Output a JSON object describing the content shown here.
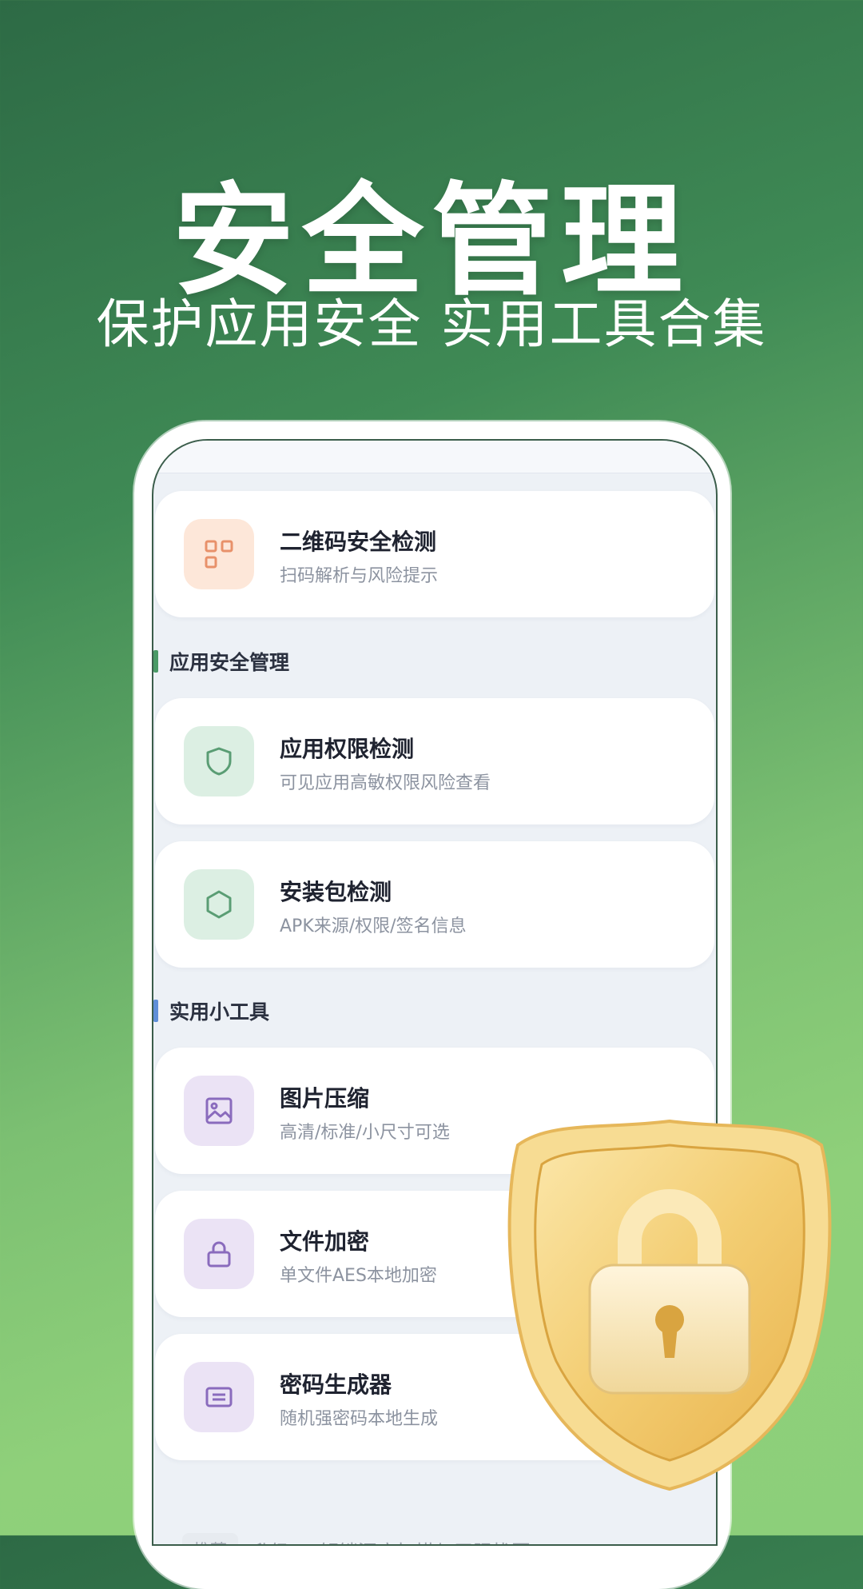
{
  "banner": {
    "title": "安全管理",
    "subtitle": "保护应用安全 实用工具合集"
  },
  "cards": [
    {
      "title": "二维码安全检测",
      "subtitle": "扫码解析与风险提示",
      "icon": "qr-code-icon",
      "color": "#e8916a"
    },
    {
      "title": "应用权限检测",
      "subtitle": "可见应用高敏权限风险查看",
      "icon": "shield-icon",
      "color": "#5a9d74"
    },
    {
      "title": "安装包检测",
      "subtitle": "APK来源/权限/签名信息",
      "icon": "hexagon-icon",
      "color": "#5a9d74"
    },
    {
      "title": "图片压缩",
      "subtitle": "高清/标准/小尺寸可选",
      "icon": "image-icon",
      "color": "#8a6bbd"
    },
    {
      "title": "文件加密",
      "subtitle": "单文件AES本地加密",
      "icon": "lock-icon",
      "color": "#8a6bbd"
    },
    {
      "title": "密码生成器",
      "subtitle": "随机强密码本地生成",
      "icon": "password-icon",
      "color": "#8a6bbd"
    }
  ],
  "sections": [
    {
      "label": "应用安全管理",
      "color": "#4a9a66"
    },
    {
      "label": "实用小工具",
      "color": "#5f8fd8"
    }
  ],
  "promo": {
    "tag": "推荐",
    "text": "升级VIP解锁深度扫描与无限找回",
    "chevron": "›"
  },
  "colors": {
    "accent_green": "#4a9a66",
    "accent_blue": "#5f8fd8",
    "shield_gold": "#f0c96a"
  }
}
